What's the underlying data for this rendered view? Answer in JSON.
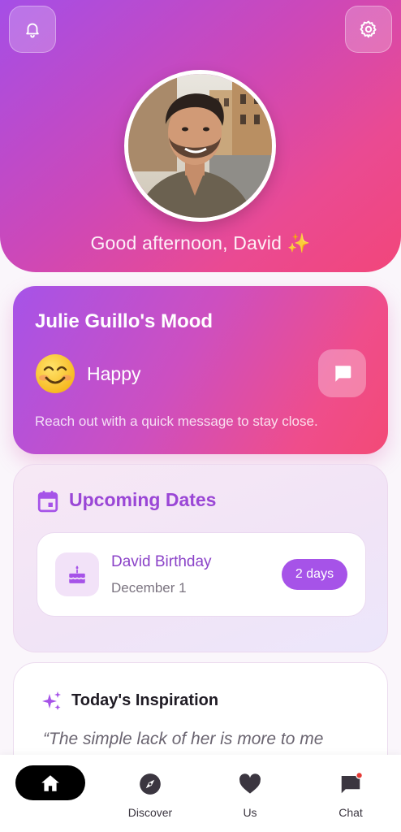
{
  "header": {
    "greeting": "Good afternoon, David ✨",
    "notifications_icon": "bell-icon",
    "settings_icon": "gear-icon",
    "avatar_alt": "David profile photo"
  },
  "mood": {
    "title": "Julie Guillo's Mood",
    "emoji": "smiling-face",
    "status": "Happy",
    "message_icon": "chat-bubble-icon",
    "subtitle": "Reach out with a quick message to stay close."
  },
  "upcoming": {
    "title": "Upcoming Dates",
    "icon": "calendar-icon",
    "events": [
      {
        "name": "David Birthday",
        "date": "December 1",
        "countdown": "2 days",
        "icon": "cake-icon"
      }
    ]
  },
  "inspiration": {
    "title": "Today's Inspiration",
    "icon": "sparkles-icon",
    "quote": "“The simple lack of her is more to me"
  },
  "nav": {
    "items": [
      {
        "label": "",
        "icon": "home-icon",
        "active": true
      },
      {
        "label": "Discover",
        "icon": "compass-icon"
      },
      {
        "label": "Us",
        "icon": "heart-icon"
      },
      {
        "label": "Chat",
        "icon": "chat-icon",
        "badge": true
      }
    ]
  },
  "colors": {
    "accent": "#a653e8",
    "pink": "#f2467a",
    "dark_text": "#1f1b24"
  }
}
